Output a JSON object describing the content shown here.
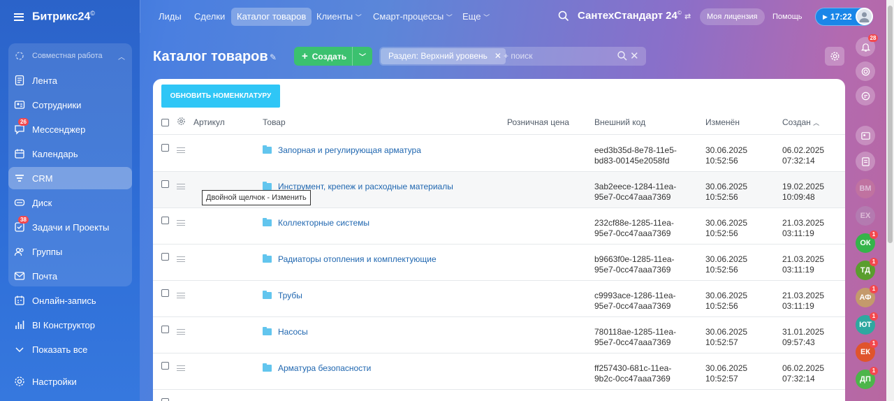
{
  "sidebar": {
    "logo": "Битрикс24",
    "logo_sup": "©",
    "group_header": "Совместная работа",
    "items": [
      {
        "label": "Лента"
      },
      {
        "label": "Сотрудники"
      },
      {
        "label": "Мессенджер",
        "badge": "26"
      },
      {
        "label": "Календарь"
      },
      {
        "label": "CRM"
      },
      {
        "label": "Диск"
      },
      {
        "label": "Задачи и Проекты",
        "badge": "38"
      },
      {
        "label": "Группы"
      },
      {
        "label": "Почта"
      },
      {
        "label": "Онлайн-запись"
      },
      {
        "label": "BI Конструктор"
      },
      {
        "label": "Показать все"
      },
      {
        "label": "Настройки"
      }
    ]
  },
  "topnav": {
    "items": [
      "Лиды",
      "Сделки",
      "Каталог товаров",
      "Клиенты",
      "Смарт-процессы",
      "Еще"
    ],
    "company": "СантехСтандарт 24",
    "company_sup": "©",
    "license": "Моя лицензия",
    "help": "Помощь",
    "time": "17:22"
  },
  "page": {
    "title": "Каталог товаров",
    "create_label": "Создать",
    "filter_chip": "Раздел: Верхний уровень",
    "search_placeholder": "+ поиск",
    "refresh_button": "ОБНОВИТЬ НОМЕНКЛАТУРУ"
  },
  "table": {
    "columns": {
      "article": "Артикул",
      "product": "Товар",
      "price": "Розничная цена",
      "ext_code": "Внешний код",
      "modified": "Изменён",
      "created": "Создан"
    },
    "rows": [
      {
        "name": "Запорная и регулирующая арматура",
        "code1": "eed3b35d-8e78-11e5-",
        "code2": "bd83-00145e2058fd",
        "mod1": "30.06.2025",
        "mod2": "10:52:56",
        "cr1": "06.02.2025",
        "cr2": "07:32:14"
      },
      {
        "name": "Инструмент, крепеж и расходные материалы",
        "code1": "3ab2eece-1284-11ea-",
        "code2": "95e7-0cc47aaa7369",
        "mod1": "30.06.2025",
        "mod2": "10:52:56",
        "cr1": "19.02.2025",
        "cr2": "10:09:48"
      },
      {
        "name": "Коллекторные системы",
        "code1": "232cf88e-1285-11ea-",
        "code2": "95e7-0cc47aaa7369",
        "mod1": "30.06.2025",
        "mod2": "10:52:56",
        "cr1": "21.03.2025",
        "cr2": "03:11:19"
      },
      {
        "name": "Радиаторы отопления и комплектующие",
        "code1": "b9663f0e-1285-11ea-",
        "code2": "95e7-0cc47aaa7369",
        "mod1": "30.06.2025",
        "mod2": "10:52:56",
        "cr1": "21.03.2025",
        "cr2": "03:11:19"
      },
      {
        "name": "Трубы",
        "code1": "c9993ace-1286-11ea-",
        "code2": "95e7-0cc47aaa7369",
        "mod1": "30.06.2025",
        "mod2": "10:52:56",
        "cr1": "21.03.2025",
        "cr2": "03:11:19"
      },
      {
        "name": "Насосы",
        "code1": "780118ae-1285-11ea-",
        "code2": "95e7-0cc47aaa7369",
        "mod1": "30.06.2025",
        "mod2": "10:52:57",
        "cr1": "31.01.2025",
        "cr2": "09:57:43"
      },
      {
        "name": "Арматура безопасности",
        "code1": "ff257430-681c-11ea-",
        "code2": "9b2c-0cc47aaa7369",
        "mod1": "30.06.2025",
        "mod2": "10:52:57",
        "cr1": "06.02.2025",
        "cr2": "07:32:14"
      }
    ],
    "tooltip": "Двойной щелчок - Изменить"
  },
  "rail": {
    "notif_badge": "28",
    "avatars": [
      {
        "initials": "ВМ",
        "color": "#c97a9a",
        "badge": ""
      },
      {
        "initials": "ЕХ",
        "color": "#b38ab8",
        "badge": ""
      },
      {
        "initials": "ОК",
        "color": "#35b44a",
        "badge": "1"
      },
      {
        "initials": "ТД",
        "color": "#5a9e2e",
        "badge": "1"
      },
      {
        "initials": "АФ",
        "color": "#c49a6c",
        "badge": "1"
      },
      {
        "initials": "ЮТ",
        "color": "#2fa8a0",
        "badge": "1"
      },
      {
        "initials": "ЕК",
        "color": "#e0542c",
        "badge": "1"
      },
      {
        "initials": "ДП",
        "color": "#4cb54a",
        "badge": "1"
      }
    ]
  },
  "colors": {
    "accent": "#2fc6f6",
    "create": "#3bc16f",
    "link": "#2067b0"
  }
}
